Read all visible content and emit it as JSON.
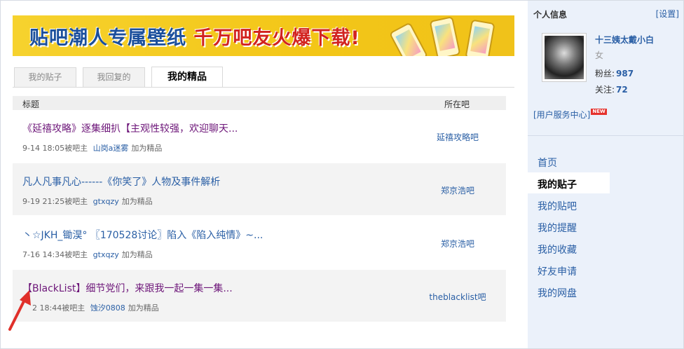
{
  "banner": {
    "text_blue": "贴吧潮人专属壁纸",
    "text_red": "千万吧友火爆下载!"
  },
  "tabs": [
    {
      "label": "我的贴子"
    },
    {
      "label": "我回复的"
    },
    {
      "label": "我的精品"
    }
  ],
  "table": {
    "col_title": "标题",
    "col_bar": "所在吧",
    "rows": [
      {
        "title": "《延禧攻略》逐集细扒【主观性较强，欢迎聊天...",
        "time": "9-14 18:05",
        "by": "被吧主",
        "user": "山岗a迷雾",
        "action": "加为精品",
        "bar": "延禧攻略吧"
      },
      {
        "title": "凡人凡事凡心------《你笑了》人物及事件解析",
        "time": "9-19 21:25",
        "by": "被吧主",
        "user": "gtxqzy",
        "action": "加为精品",
        "bar": "郑京浩吧"
      },
      {
        "title": "丶☆JKH_锄淏° 〖170528讨论〗陷入《陷入纯情》~...",
        "time": "7-16 14:34",
        "by": "被吧主",
        "user": "gtxqzy",
        "action": "加为精品",
        "bar": "郑京浩吧"
      },
      {
        "title": "【BlackList】细节党们，来跟我一起一集一集...",
        "time": "2 18:44",
        "by": "被吧主",
        "user": "蚀汐0808",
        "action": "加为精品",
        "bar": "theblacklist吧"
      }
    ]
  },
  "sidebar": {
    "title": "个人信息",
    "settings": "[设置]",
    "username": "十三姨太戴小白",
    "gender": "女",
    "fans_label": "粉丝:",
    "fans": "987",
    "follow_label": "关注:",
    "follow": "72",
    "service": "[用户服务中心]",
    "new_badge": "NEW",
    "nav": [
      {
        "label": "首页"
      },
      {
        "label": "我的贴子"
      },
      {
        "label": "我的贴吧"
      },
      {
        "label": "我的提醒"
      },
      {
        "label": "我的收藏"
      },
      {
        "label": "好友申请"
      },
      {
        "label": "我的网盘"
      }
    ]
  },
  "colors": {
    "link": "#2a5fa5",
    "title_purple": "#6d1679",
    "sidebar_bg": "#ebf1fa",
    "arrow": "#e0302a"
  }
}
